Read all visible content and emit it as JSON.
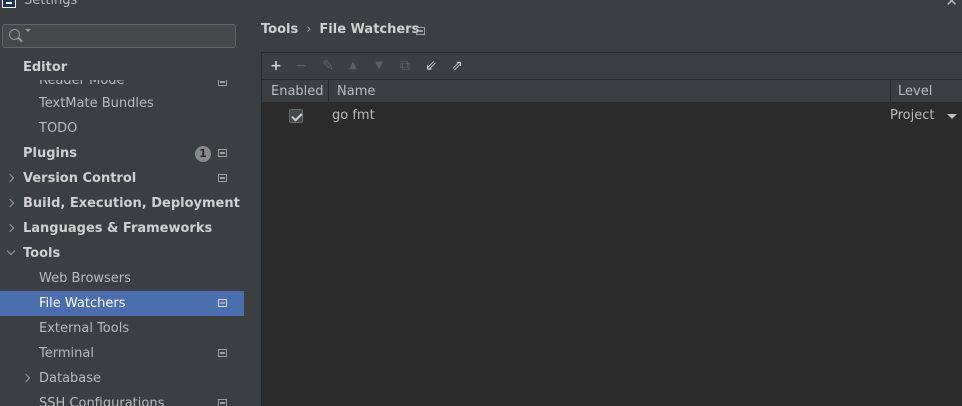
{
  "window": {
    "title": "Settings"
  },
  "sidebar": {
    "search_placeholder": "",
    "section_header": "Editor",
    "items": [
      {
        "label": "Reader Mode"
      },
      {
        "label": "TextMate Bundles"
      },
      {
        "label": "TODO"
      },
      {
        "label": "Plugins",
        "badge": "1"
      },
      {
        "label": "Version Control"
      },
      {
        "label": "Build, Execution, Deployment"
      },
      {
        "label": "Languages & Frameworks"
      },
      {
        "label": "Tools"
      },
      {
        "label": "Web Browsers"
      },
      {
        "label": "File Watchers"
      },
      {
        "label": "External Tools"
      },
      {
        "label": "Terminal"
      },
      {
        "label": "Database"
      },
      {
        "label": "SSH Configurations"
      }
    ]
  },
  "main": {
    "breadcrumb": {
      "parent": "Tools",
      "separator": "›",
      "current": "File Watchers"
    },
    "toolbar": {
      "add": "+",
      "remove": "−",
      "edit": "✎",
      "up": "▲",
      "down": "▼",
      "copy": "⧉",
      "import": "⇙",
      "export": "⇗"
    },
    "table": {
      "columns": [
        "Enabled",
        "Name",
        "Level"
      ],
      "rows": [
        {
          "enabled": true,
          "name": "go fmt",
          "level": "Project"
        }
      ]
    }
  },
  "colors": {
    "background": "#3c3f41",
    "table_background": "#2b2b2b",
    "selection": "#4b6eaf",
    "text": "#bbbbbb"
  }
}
